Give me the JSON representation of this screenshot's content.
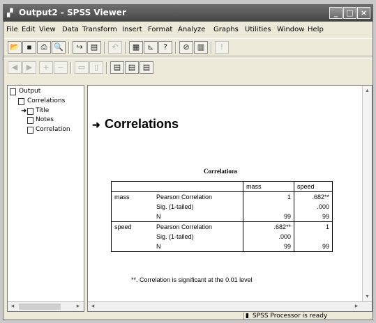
{
  "window": {
    "title": "Output2 - SPSS Viewer"
  },
  "menu": [
    "File",
    "Edit",
    "View",
    "Data",
    "Transform",
    "Insert",
    "Format",
    "Analyze",
    "Graphs",
    "Utilities",
    "Window",
    "Help"
  ],
  "outline": {
    "root": "Output",
    "group": "Correlations",
    "items": [
      "Title",
      "Notes",
      "Correlation"
    ]
  },
  "content": {
    "heading": "Correlations",
    "table_title": "Correlations",
    "columns": [
      "mass",
      "speed"
    ],
    "rows": [
      {
        "var": "mass",
        "stat": "Pearson Correlation",
        "mass": "1",
        "speed": ".682**"
      },
      {
        "var": "",
        "stat": "Sig. (1-tailed)",
        "mass": "",
        "speed": ".000"
      },
      {
        "var": "",
        "stat": "N",
        "mass": "99",
        "speed": "99"
      },
      {
        "var": "speed",
        "stat": "Pearson Correlation",
        "mass": ".682**",
        "speed": "1"
      },
      {
        "var": "",
        "stat": "Sig. (1-tailed)",
        "mass": ".000",
        "speed": ""
      },
      {
        "var": "",
        "stat": "N",
        "mass": "99",
        "speed": "99"
      }
    ],
    "footnote": "**. Correlation is significant at the 0.01 level"
  },
  "status": {
    "processor": "SPSS Processor  is ready"
  }
}
